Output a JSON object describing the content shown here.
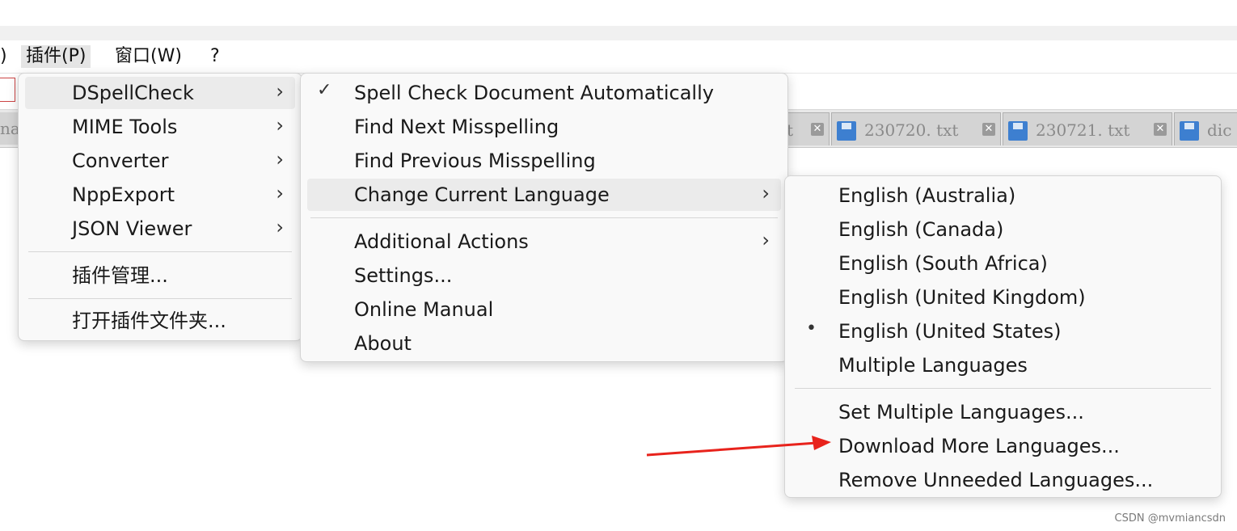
{
  "menubar": {
    "partial_item": ")",
    "items": [
      "插件(P)",
      "窗口(W)",
      "?"
    ]
  },
  "tabs": [
    {
      "label": "t"
    },
    {
      "label": "230720. txt"
    },
    {
      "label": "230721. txt"
    },
    {
      "label": "dic"
    }
  ],
  "tab_left_fragment": "na",
  "plugins_menu": {
    "items": [
      "DSpellCheck",
      "MIME Tools",
      "Converter",
      "NppExport",
      "JSON Viewer"
    ],
    "manage": "插件管理...",
    "open_folder": "打开插件文件夹..."
  },
  "dspell_menu": {
    "items": [
      "Spell Check Document Automatically",
      "Find Next Misspelling",
      "Find Previous Misspelling",
      "Change Current Language"
    ],
    "items2": [
      "Additional Actions",
      "Settings...",
      "Online Manual",
      "About"
    ],
    "check_mark": "✓"
  },
  "language_menu": {
    "languages": [
      "English (Australia)",
      "English (Canada)",
      "English (South Africa)",
      "English (United Kingdom)",
      "English (United States)",
      "Multiple Languages"
    ],
    "selected_index": 4,
    "bullet": "•",
    "actions": [
      "Set Multiple Languages...",
      "Download More Languages...",
      "Remove Unneeded Languages..."
    ]
  },
  "submenu_arrow": "›",
  "close_glyph": "✕",
  "annotation_color": "#e8231c",
  "watermark": "CSDN @mvmiancsdn"
}
